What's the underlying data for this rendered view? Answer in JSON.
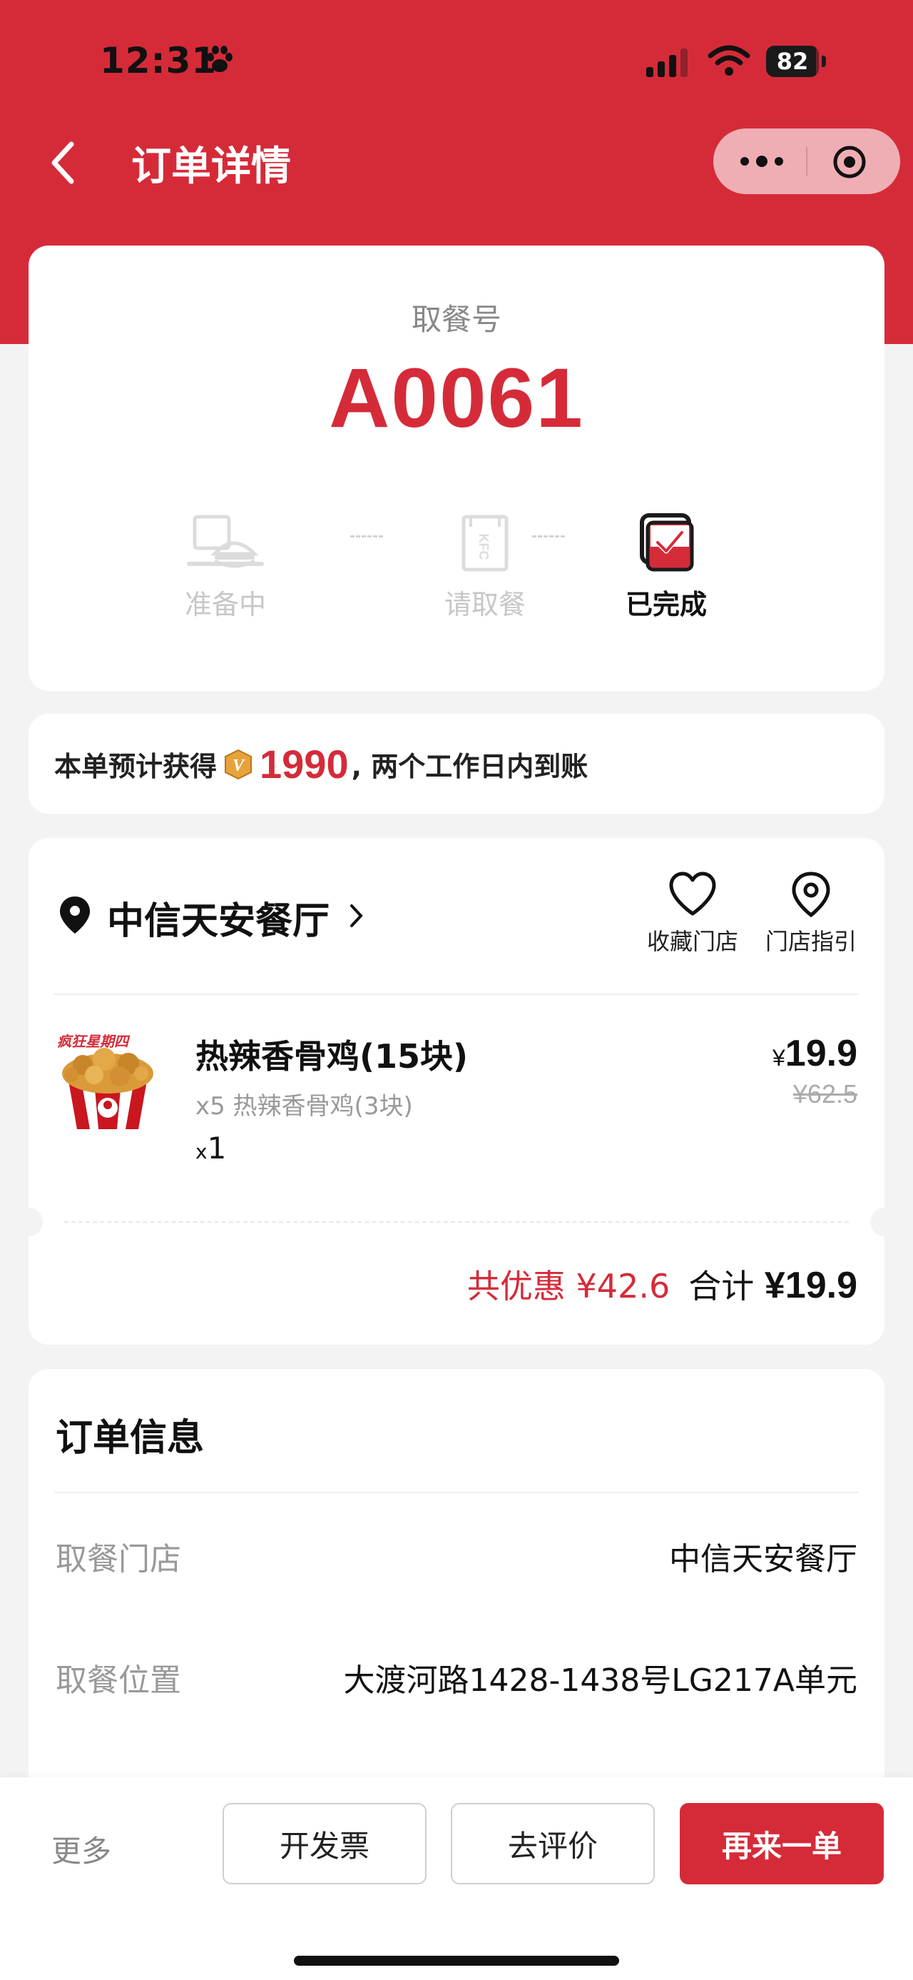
{
  "status_bar": {
    "time": "12:31",
    "battery": "82"
  },
  "nav": {
    "title": "订单详情"
  },
  "pickup": {
    "label": "取餐号",
    "number": "A0061",
    "steps": [
      {
        "label": "准备中",
        "icon": "tray-burger-icon",
        "state": "inactive"
      },
      {
        "label": "请取餐",
        "icon": "kfc-bag-icon",
        "state": "inactive"
      },
      {
        "label": "已完成",
        "icon": "completed-check-icon",
        "state": "active"
      }
    ]
  },
  "points": {
    "prefix": "本单预计获得",
    "value": "1990",
    "suffix": ", 两个工作日内到账",
    "icon": "v-coin-icon"
  },
  "store": {
    "name": "中信天安餐厅",
    "actions": [
      {
        "label": "收藏门店",
        "icon": "heart-icon"
      },
      {
        "label": "门店指引",
        "icon": "map-pin-icon"
      }
    ]
  },
  "order_item": {
    "name": "热辣香骨鸡(15块)",
    "sub": "x5 热辣香骨鸡(3块)",
    "qty_prefix": "x",
    "qty": "1",
    "currency": "¥",
    "price": "19.9",
    "original_price": "¥62.5",
    "badge_text": "疯狂星期四"
  },
  "totals": {
    "discount_label": "共优惠",
    "discount_value": "¥42.6",
    "total_label": "合计",
    "total_value": "¥19.9"
  },
  "order_info": {
    "title": "订单信息",
    "rows": [
      {
        "key": "取餐门店",
        "value": "中信天安餐厅"
      },
      {
        "key": "取餐位置",
        "value": "大渡河路1428-1438号LG217A单元"
      }
    ]
  },
  "bottom_bar": {
    "more": "更多",
    "invoice": "开发票",
    "review": "去评价",
    "reorder": "再来一单"
  },
  "colors": {
    "brand_red": "#d52b39",
    "background": "#f3f3f3"
  }
}
